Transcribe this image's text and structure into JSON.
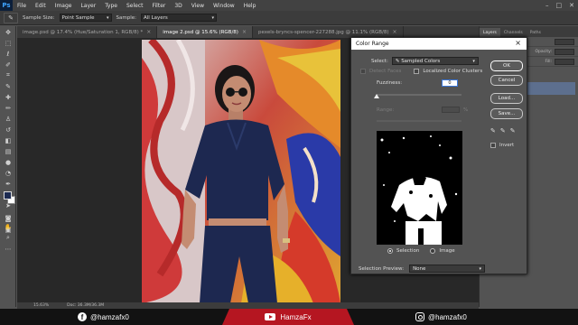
{
  "app": {
    "logo": "Ps"
  },
  "menu": [
    "File",
    "Edit",
    "Image",
    "Layer",
    "Type",
    "Select",
    "Filter",
    "3D",
    "View",
    "Window",
    "Help"
  ],
  "window_controls": [
    "–",
    "□",
    "✕"
  ],
  "options": {
    "sample_size_label": "Sample Size:",
    "sample_size_value": "Point Sample",
    "sample_label": "Sample:",
    "sample_value": "All Layers"
  },
  "tabs": [
    {
      "label": "image.psd @ 17.4% (Hue/Saturation 1, RGB/8) *",
      "active": false
    },
    {
      "label": "image 2.psd @ 15.6% (RGB/8)",
      "active": true
    },
    {
      "label": "pexels-bryncs-spencer-227288.jpg @ 11.1% (RGB/8)",
      "active": false
    }
  ],
  "status": {
    "zoom": "15.63%",
    "doc": "Doc: 36.3M/36.3M"
  },
  "right_panel": {
    "tabs": [
      "Layers",
      "Channels",
      "Paths"
    ],
    "opacity_label": "Opacity:",
    "fill_label": "Fill:"
  },
  "dialog": {
    "title": "Color Range",
    "select_label": "Select:",
    "select_value": "Sampled Colors",
    "detect_faces": "Detect Faces",
    "localized": "Localized Color Clusters",
    "fuzziness_label": "Fuzziness:",
    "fuzziness_value": "0",
    "fuzziness": 0,
    "range_label": "Range:",
    "range_unit": "%",
    "selection_label": "Selection",
    "image_label": "Image",
    "buttons": {
      "ok": "OK",
      "cancel": "Cancel",
      "load": "Load...",
      "save": "Save..."
    },
    "invert_label": "Invert",
    "selection_preview_label": "Selection Preview:",
    "selection_preview_value": "None"
  },
  "social": {
    "facebook": "@hamzafx0",
    "youtube": "HamzaFx",
    "instagram": "@hamzafx0"
  },
  "colors": {
    "foreground": "#1d2b52",
    "background": "#ffffff",
    "accent_red": "#b51621"
  }
}
